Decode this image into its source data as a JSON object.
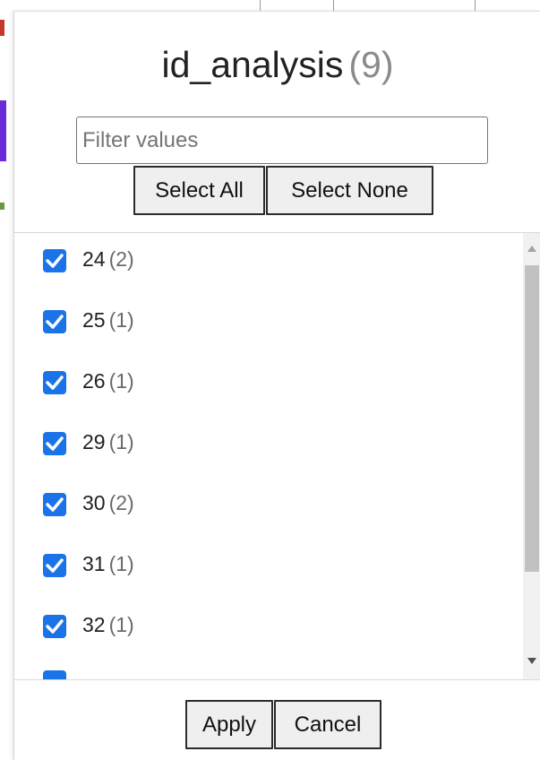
{
  "filter_popup": {
    "title": "id_analysis",
    "title_count": "(9)",
    "filter_placeholder": "Filter values",
    "filter_value": "",
    "select_all_label": "Select All",
    "select_none_label": "Select None",
    "items": [
      {
        "value": "24",
        "count": "(2)",
        "checked": true
      },
      {
        "value": "25",
        "count": "(1)",
        "checked": true
      },
      {
        "value": "26",
        "count": "(1)",
        "checked": true
      },
      {
        "value": "29",
        "count": "(1)",
        "checked": true
      },
      {
        "value": "30",
        "count": "(2)",
        "checked": true
      },
      {
        "value": "31",
        "count": "(1)",
        "checked": true
      },
      {
        "value": "32",
        "count": "(1)",
        "checked": true
      }
    ],
    "apply_label": "Apply",
    "cancel_label": "Cancel",
    "checkbox_color": "#1a73e8"
  }
}
